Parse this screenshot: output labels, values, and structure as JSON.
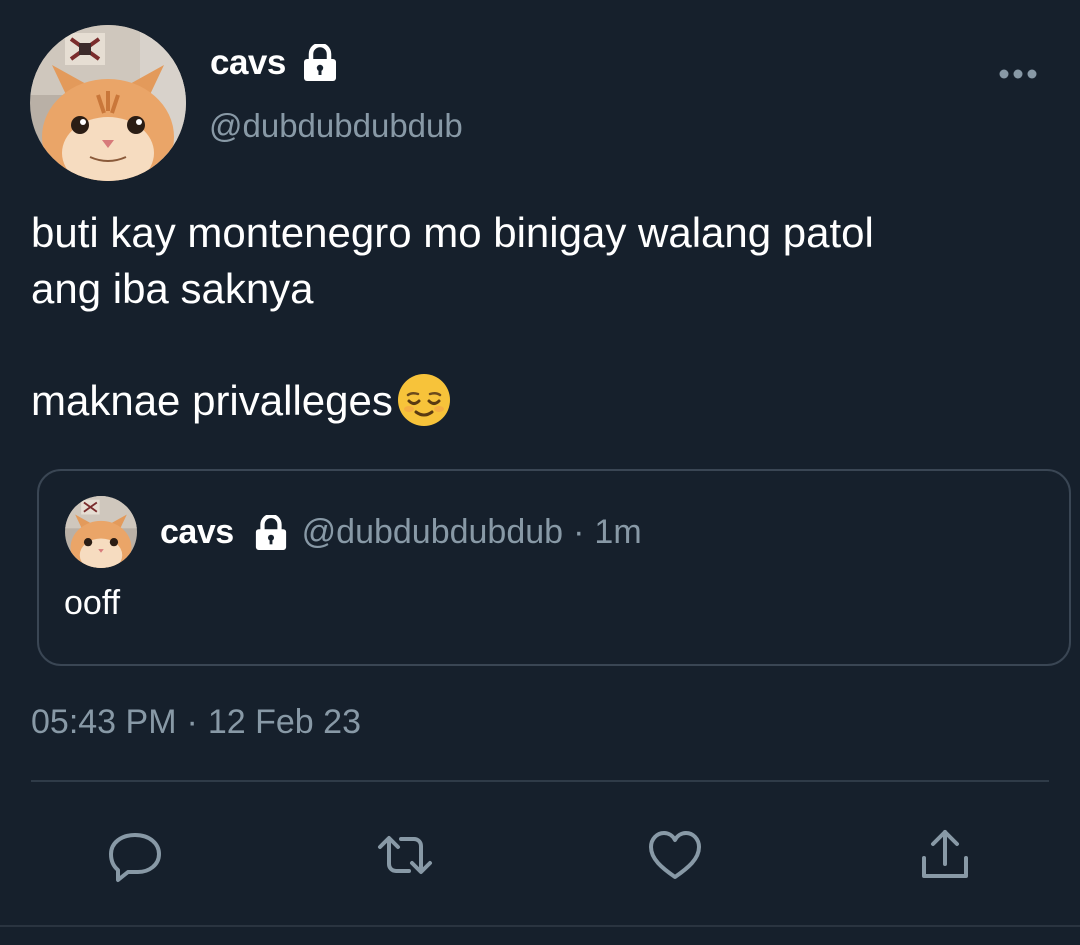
{
  "author": {
    "display_name": "cavs",
    "handle": "@dubdubdubdub",
    "protected": true
  },
  "tweet": {
    "text": "buti kay montenegro mo binigay walang patol\nang iba saknya\n\nmaknae privalleges",
    "emoji": "relieved-face"
  },
  "quoted_tweet": {
    "display_name": "cavs",
    "handle": "@dubdubdubdub",
    "separator": "·",
    "time": "1m",
    "text": "ooff"
  },
  "meta": {
    "time": "05:43 PM",
    "separator": "·",
    "date": "12 Feb 23"
  },
  "actions": [
    "reply-icon",
    "retweet-icon",
    "like-icon",
    "share-icon"
  ],
  "colors": {
    "background": "#16202c",
    "secondary_text": "#8899a6",
    "border": "#3a4654"
  }
}
